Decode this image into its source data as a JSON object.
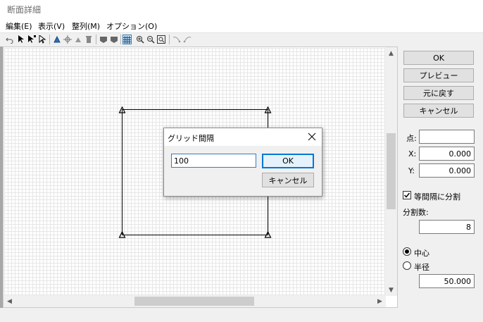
{
  "window": {
    "title": "断面詳細"
  },
  "menu": [
    "編集(E)",
    "表示(V)",
    "整列(M)",
    "オプション(O)"
  ],
  "toolbar_icons": [
    "undo-icon",
    "select-arrow-icon",
    "select-vertex-icon",
    "select-pointer-icon",
    "flip-icon",
    "move-icon",
    "copy-icon",
    "delete-icon",
    "shape-a-icon",
    "shape-b-icon",
    "grid-icon",
    "zoom-in-icon",
    "zoom-out-icon",
    "zoom-fit-icon",
    "arc-cw-icon",
    "arc-ccw-icon"
  ],
  "right_panel": {
    "ok_label": "OK",
    "preview_label": "プレビュー",
    "revert_label": "元に戻す",
    "cancel_label": "キャンセル",
    "point_label": "点:",
    "point_value": "",
    "x_label": "X:",
    "x_value": "0.000",
    "y_label": "Y:",
    "y_value": "0.000",
    "equal_interval_label": "等間隔に分割",
    "equal_interval_checked": true,
    "divisions_label": "分割数:",
    "divisions_value": "8",
    "center_label": "中心",
    "center_selected": true,
    "radius_label": "半径",
    "radius_value": "50.000"
  },
  "dialog": {
    "title": "グリッド間隔",
    "input_value": "100",
    "ok_label": "OK",
    "cancel_label": "キャンセル"
  }
}
